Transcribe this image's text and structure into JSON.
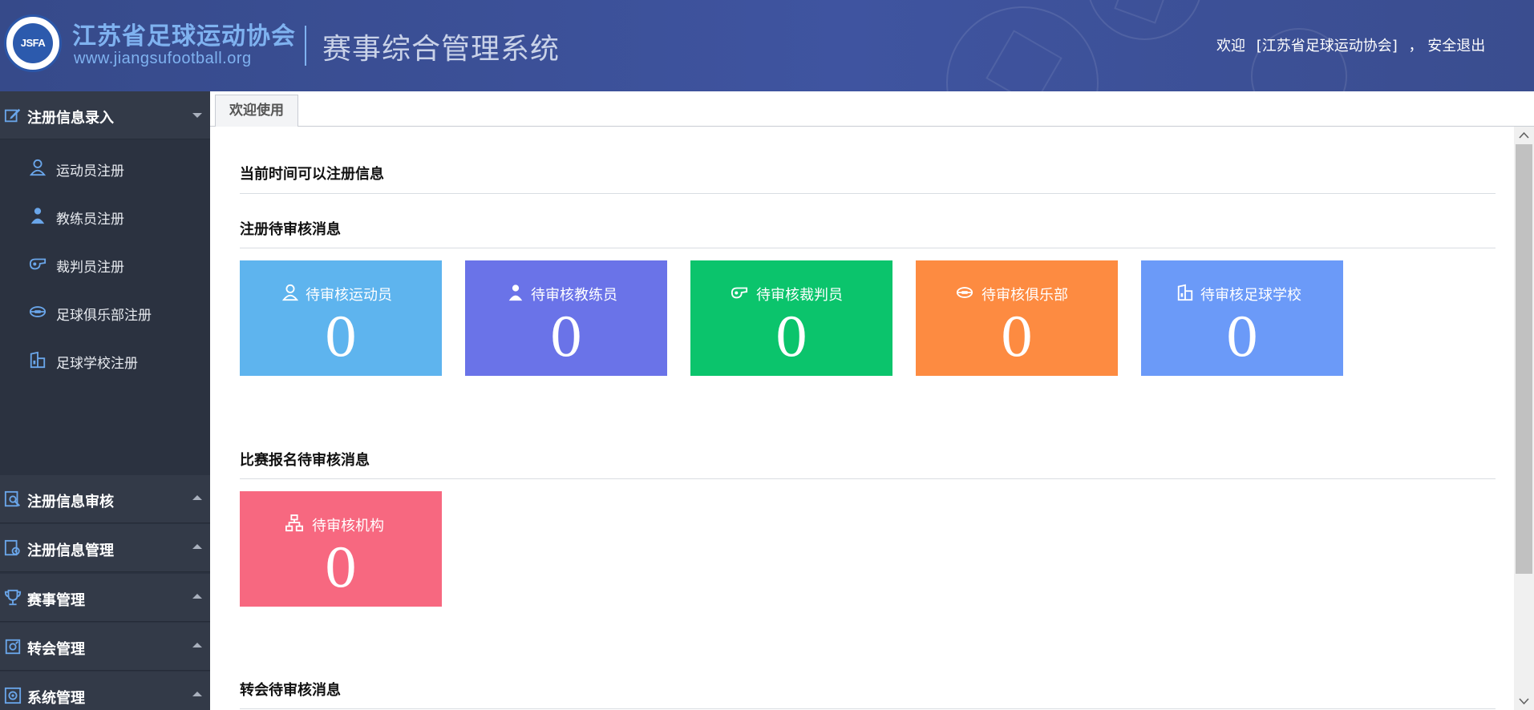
{
  "header": {
    "org_name": "江苏省足球运动协会",
    "org_url": "www.jiangsufootball.org",
    "logo_text": "JSFA",
    "system_title": "赛事综合管理系统",
    "welcome": "欢迎",
    "user_name": "[江苏省足球运动协会]",
    "separator": "，",
    "logout": "安全退出"
  },
  "sidebar": {
    "expanded_group": {
      "label": "注册信息录入",
      "icon": "edit-icon"
    },
    "sub_items": [
      {
        "label": "运动员注册",
        "icon": "athlete-icon"
      },
      {
        "label": "教练员注册",
        "icon": "coach-icon"
      },
      {
        "label": "裁判员注册",
        "icon": "whistle-icon"
      },
      {
        "label": "足球俱乐部注册",
        "icon": "club-icon"
      },
      {
        "label": "足球学校注册",
        "icon": "school-icon"
      }
    ],
    "collapsed_groups": [
      {
        "label": "注册信息审核",
        "icon": "search-doc-icon"
      },
      {
        "label": "注册信息管理",
        "icon": "doc-gear-icon"
      },
      {
        "label": "赛事管理",
        "icon": "trophy-icon"
      },
      {
        "label": "转会管理",
        "icon": "transfer-icon"
      },
      {
        "label": "系统管理",
        "icon": "gear-icon"
      }
    ]
  },
  "tabs": [
    {
      "label": "欢迎使用"
    }
  ],
  "main": {
    "registration_time_title": "当前时间可以注册信息",
    "pending_registration_title": "注册待审核消息",
    "pending_registration_cards": [
      {
        "label": "待审核运动员",
        "count": "0",
        "color": "#5eb4ee",
        "icon": "athlete-icon"
      },
      {
        "label": "待审核教练员",
        "count": "0",
        "color": "#6a73e8",
        "icon": "coach-icon"
      },
      {
        "label": "待审核裁判员",
        "count": "0",
        "color": "#0bc46c",
        "icon": "whistle-icon"
      },
      {
        "label": "待审核俱乐部",
        "count": "0",
        "color": "#fd8b41",
        "icon": "club-icon"
      },
      {
        "label": "待审核足球学校",
        "count": "0",
        "color": "#6b9af8",
        "icon": "school-icon"
      }
    ],
    "pending_match_title": "比赛报名待审核消息",
    "pending_match_cards": [
      {
        "label": "待审核机构",
        "count": "0",
        "color": "#f76880",
        "icon": "org-chart-icon"
      }
    ],
    "pending_transfer_title": "转会待审核消息"
  }
}
